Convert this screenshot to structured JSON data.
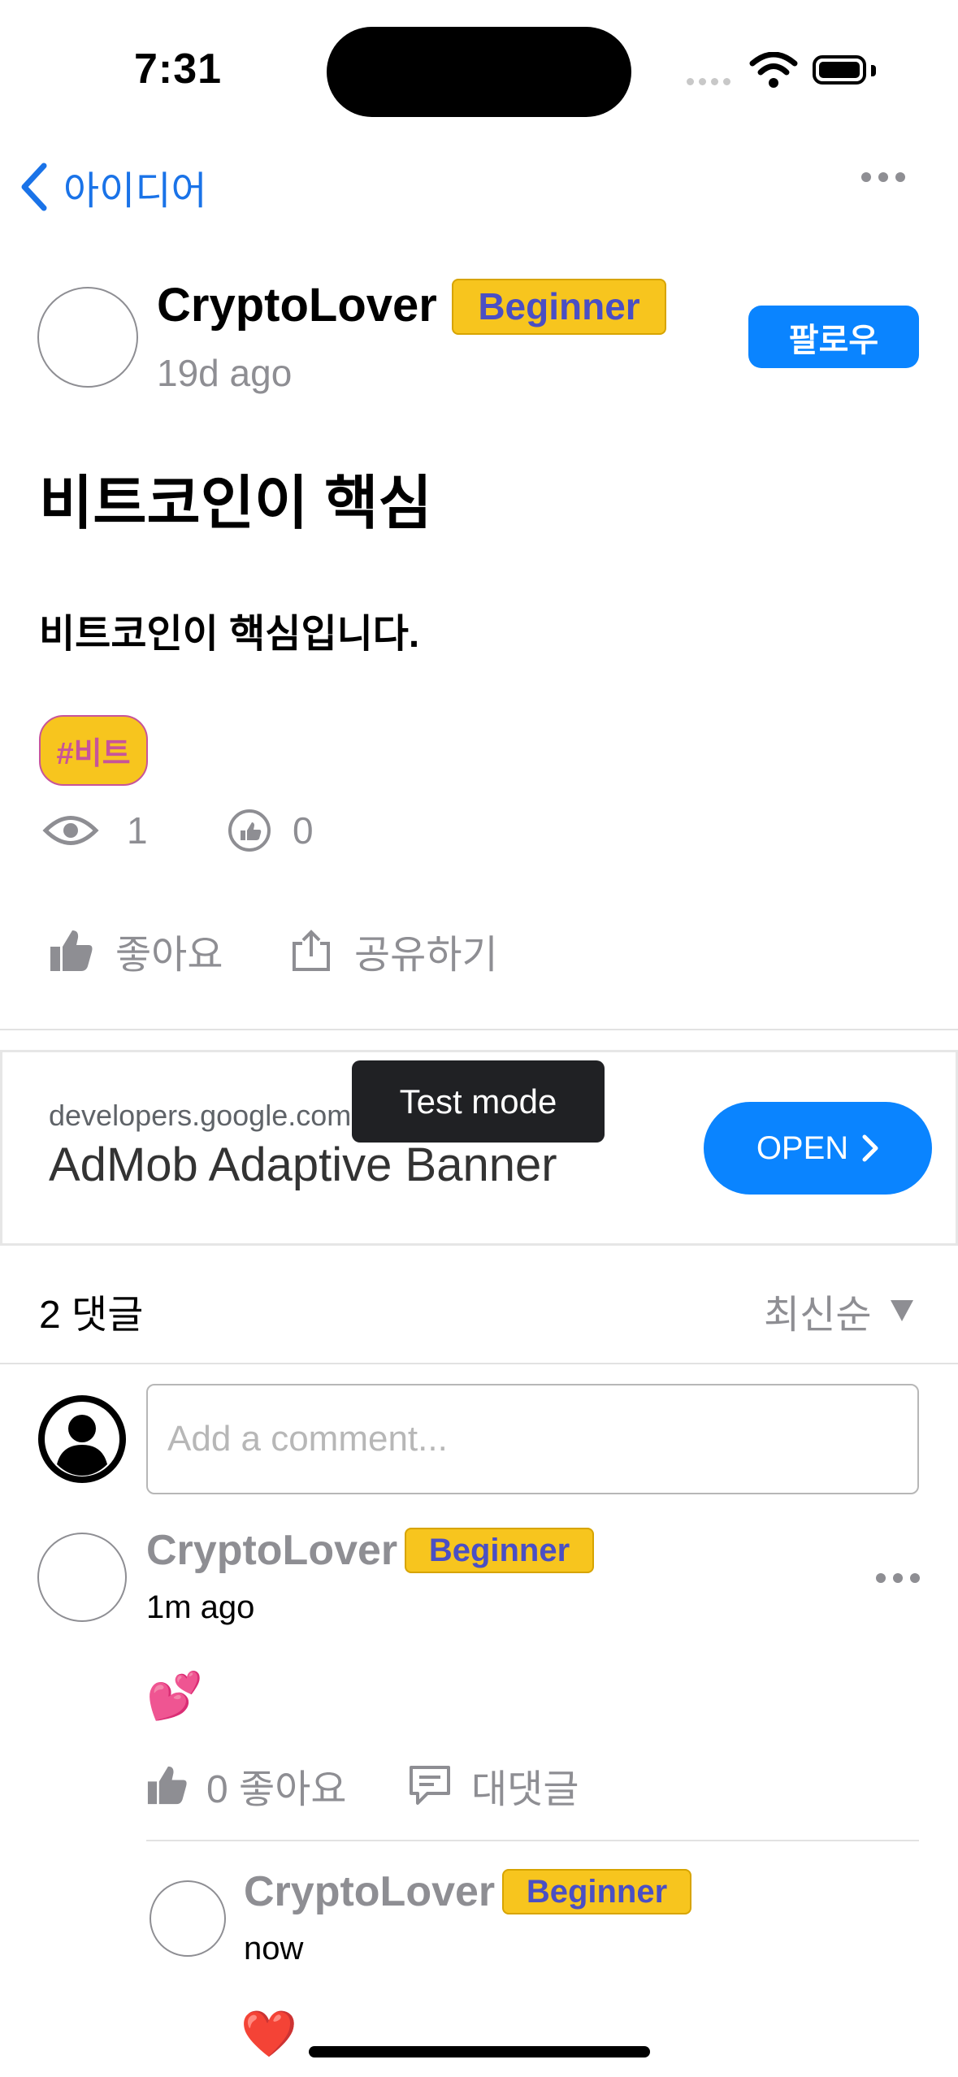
{
  "status_bar": {
    "time": "7:31"
  },
  "nav": {
    "back_label": "아이디어"
  },
  "post": {
    "author_name": "CryptoLover",
    "author_badge": "Beginner",
    "time": "19d ago",
    "follow_label": "팔로우",
    "title": "비트코인이 핵심",
    "body": "비트코인이 핵심입니다.",
    "tag": "#비트",
    "views": "1",
    "likes": "0",
    "like_label": "좋아요",
    "share_label": "공유하기"
  },
  "ad": {
    "url": "developers.google.com",
    "title": "AdMob Adaptive Banner",
    "open_label": "OPEN",
    "test_mode": "Test mode"
  },
  "comments_header": {
    "count_label": "2 댓글",
    "sort_label": "최신순"
  },
  "comment_input": {
    "placeholder": "Add a comment..."
  },
  "comments": [
    {
      "name": "CryptoLover",
      "badge": "Beginner",
      "time": "1m ago",
      "text": "💕",
      "like_count": "0 좋아요",
      "reply_label": "대댓글"
    }
  ],
  "replies": [
    {
      "name": "CryptoLover",
      "badge": "Beginner",
      "time": "now",
      "text": "❤️"
    }
  ],
  "colors": {
    "accent": "#0a84ff",
    "badge": "#f7c51e",
    "badge_text": "#4a4fc4",
    "tag_text": "#c7549a",
    "muted": "#8e8e93"
  }
}
